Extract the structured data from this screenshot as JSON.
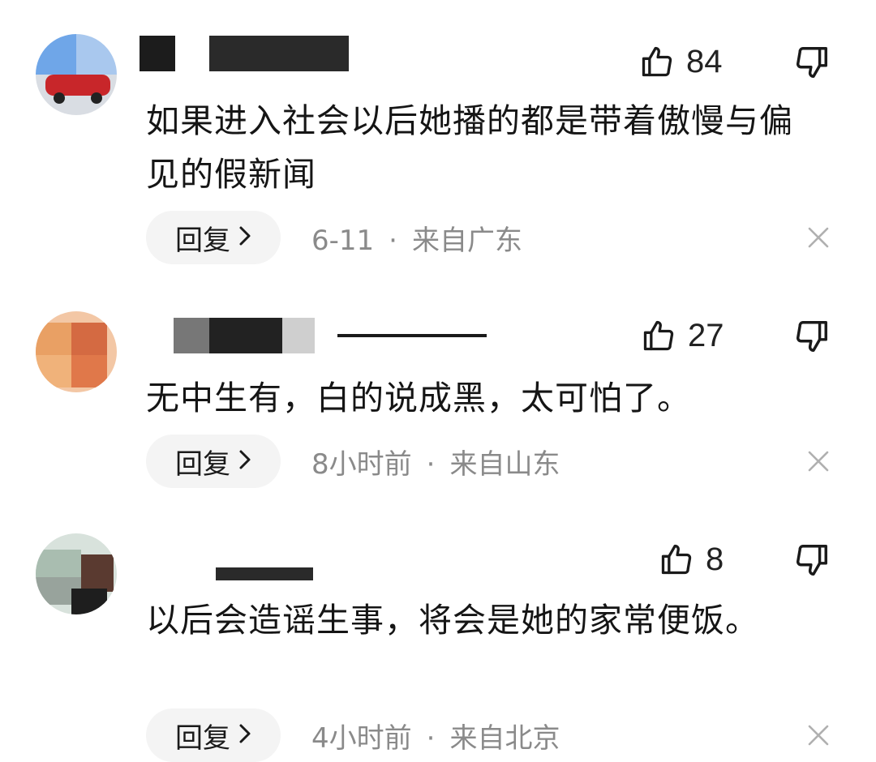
{
  "comments": [
    {
      "likes": "84",
      "text": "如果进入社会以后她播的都是带着傲慢与偏见的假新闻",
      "reply_label": "回复",
      "time": "6-11",
      "location": "来自广东",
      "icons": [
        "thumbs-up-icon",
        "thumbs-down-icon",
        "chevron-right-icon",
        "close-icon"
      ]
    },
    {
      "likes": "27",
      "text": "无中生有，白的说成黑，太可怕了。",
      "reply_label": "回复",
      "time": "8小时前",
      "location": "来自山东",
      "icons": [
        "thumbs-up-icon",
        "thumbs-down-icon",
        "chevron-right-icon",
        "close-icon"
      ]
    },
    {
      "likes": "8",
      "text": "以后会造谣生事，将会是她的家常便饭。",
      "reply_label": "回复",
      "time": "4小时前",
      "location": "来自北京",
      "icons": [
        "thumbs-up-icon",
        "thumbs-down-icon",
        "chevron-right-icon",
        "close-icon"
      ]
    }
  ],
  "separator": "·"
}
